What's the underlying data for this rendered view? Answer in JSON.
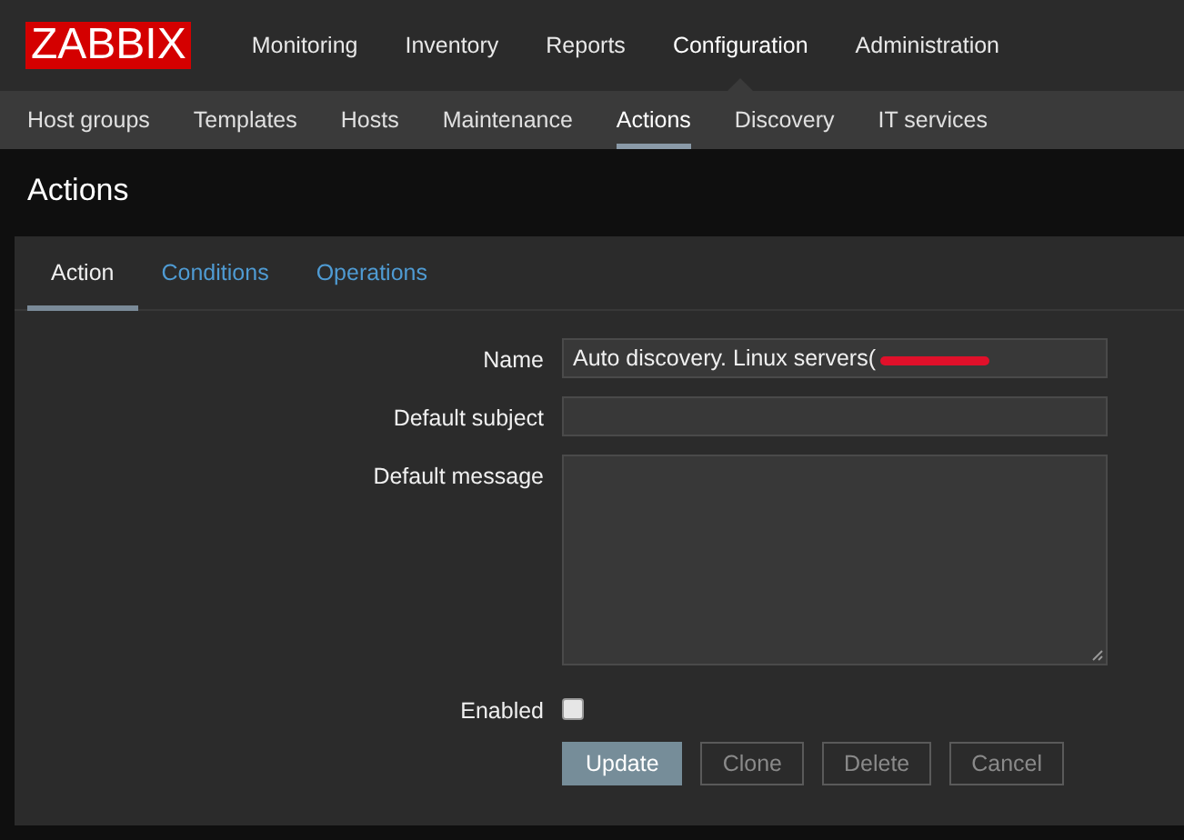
{
  "logo": "ZABBIX",
  "main_menu": [
    {
      "label": "Monitoring",
      "selected": false
    },
    {
      "label": "Inventory",
      "selected": false
    },
    {
      "label": "Reports",
      "selected": false
    },
    {
      "label": "Configuration",
      "selected": true
    },
    {
      "label": "Administration",
      "selected": false
    }
  ],
  "sub_menu": [
    {
      "label": "Host groups",
      "selected": false
    },
    {
      "label": "Templates",
      "selected": false
    },
    {
      "label": "Hosts",
      "selected": false
    },
    {
      "label": "Maintenance",
      "selected": false
    },
    {
      "label": "Actions",
      "selected": true
    },
    {
      "label": "Discovery",
      "selected": false
    },
    {
      "label": "IT services",
      "selected": false
    }
  ],
  "page_title": "Actions",
  "tabs": [
    {
      "label": "Action",
      "selected": true
    },
    {
      "label": "Conditions",
      "selected": false
    },
    {
      "label": "Operations",
      "selected": false
    }
  ],
  "form": {
    "name": {
      "label": "Name",
      "value": "Auto discovery. Linux servers(",
      "redacted": true
    },
    "default_subject": {
      "label": "Default subject"
    },
    "default_message": {
      "label": "Default message"
    },
    "enabled": {
      "label": "Enabled",
      "checked": false
    }
  },
  "buttons": [
    {
      "label": "Update",
      "kind": "primary"
    },
    {
      "label": "Clone",
      "kind": "secondary"
    },
    {
      "label": "Delete",
      "kind": "secondary"
    },
    {
      "label": "Cancel",
      "kind": "secondary"
    }
  ]
}
